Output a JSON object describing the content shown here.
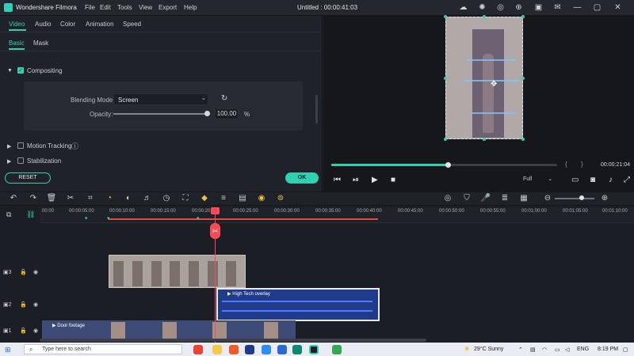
{
  "app": {
    "title": "Wondershare Filmora",
    "menu": [
      "File",
      "Edit",
      "Tools",
      "View",
      "Export",
      "Help"
    ],
    "document_title": "Untitled : 00:00:41:03"
  },
  "panel": {
    "tabs": [
      "Video",
      "Audio",
      "Color",
      "Animation",
      "Speed"
    ],
    "subtabs": [
      "Basic",
      "Mask"
    ],
    "compositing_label": "Compositing",
    "blending_mode_label": "Blending Mode:",
    "blending_mode_value": "Screen",
    "opacity_label": "Opacity:",
    "opacity_value": "100.00",
    "opacity_unit": "%",
    "opacity_fraction": 1.0,
    "motion_tracking_label": "Motion Tracking",
    "stabilization_label": "Stabilization",
    "reset_label": "RESET",
    "ok_label": "OK"
  },
  "preview": {
    "timecode": "00:00:21:04",
    "quality": "Full",
    "progress_fraction": 0.51
  },
  "timeline": {
    "ruler_ticks": [
      "00:00",
      "00:00:05:00",
      "00:00:10:00",
      "00:00:15:00",
      "00:00:20:00",
      "00:00:25:00",
      "00:00:30:00",
      "00:00:35:00",
      "00:00:40:00",
      "00:00:45:00",
      "00:00:50:00",
      "00:00:55:00",
      "00:01:00:00",
      "00:01:05:00",
      "00:01:10:00"
    ],
    "tracks": [
      {
        "label": "3",
        "clip": ""
      },
      {
        "label": "2",
        "clip": "High Tech overlay"
      },
      {
        "label": "1",
        "clip": "Door footage"
      }
    ]
  },
  "taskbar": {
    "search_placeholder": "Type here to search",
    "weather": "29°C  Sunny",
    "language": "ENG",
    "time": "8:19 PM"
  },
  "colors": {
    "accent": "#2fd1b3",
    "playhead": "#ff4a55",
    "overlay_clip": "#203b8a"
  }
}
